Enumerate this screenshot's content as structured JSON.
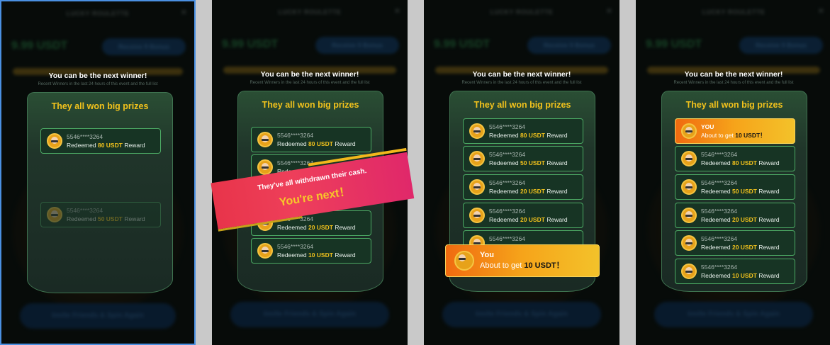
{
  "background": {
    "app_title": "LUCKY ROULETTE",
    "close_glyph": "✕",
    "balance": "9.99 USDT",
    "cta_label": "Receive 9 Bonus",
    "invite_label": "Invite Friends & Spin Again"
  },
  "headline": "You can be the next winner!",
  "subline": "Recent Winners in the last 24 hours of this event and the full list",
  "panel_title": "They all won big prizes",
  "uid": "5546****3264",
  "redeemed_prefix": "Redeemed",
  "reward_suffix": "Reward",
  "amounts": {
    "a80": "80 USDT",
    "a50": "50 USDT",
    "a20": "20 USDT",
    "a10": "10 USDT"
  },
  "banner": {
    "line1": "They've all withdrawn their cash.",
    "line2": "You're next！"
  },
  "you_card_large": {
    "label": "You",
    "prefix": "About to get",
    "amount": "10 USDT！"
  },
  "you_card_small": {
    "label": "YOU",
    "prefix": "About to get",
    "amount": "10 USDT！"
  },
  "colors": {
    "accent_gold": "#f2c21c",
    "card_border": "#4caa64",
    "selected_outline": "#4a90e2",
    "banner_red": "#e8344a"
  }
}
